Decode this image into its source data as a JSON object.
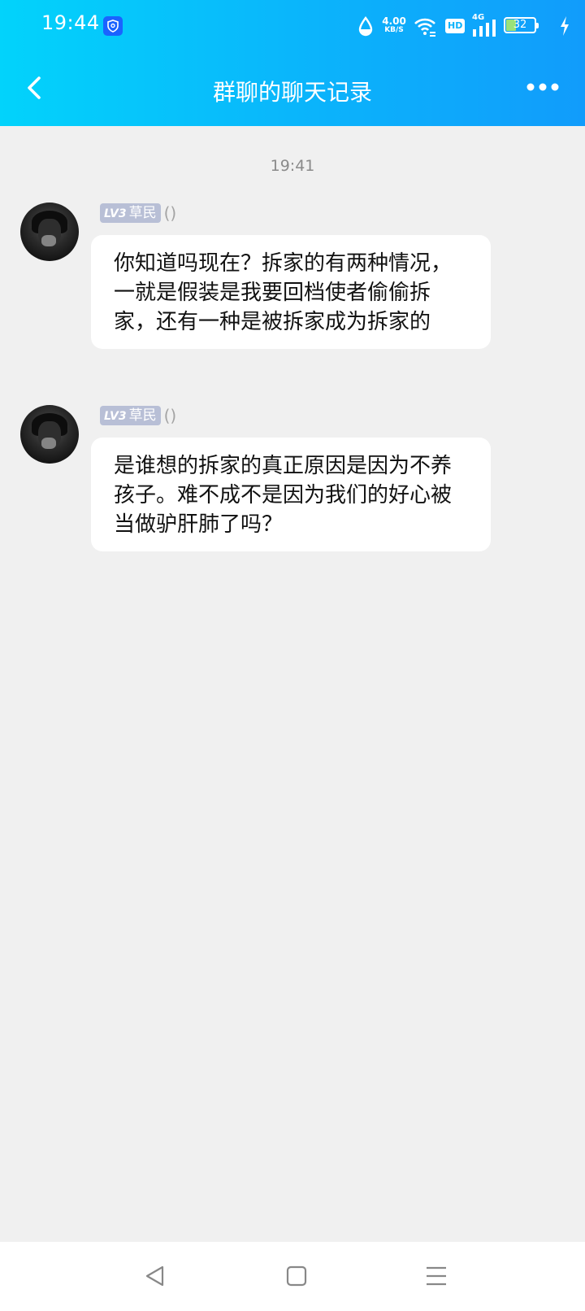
{
  "status_bar": {
    "time": "19:44",
    "speed_value": "4.00",
    "speed_unit": "KB/S",
    "hd_label": "HD",
    "network_label": "4G",
    "battery_level": "32"
  },
  "header": {
    "title": "群聊的聊天记录",
    "back_icon": "chevron-left-icon",
    "more_icon": "more-dots-icon"
  },
  "chat": {
    "timestamp": "19:41",
    "messages": [
      {
        "badge_level": "LV3",
        "badge_rank": "草民",
        "nickname": "()",
        "text": "你知道吗现在？拆家的有两种情况，一就是假装是我要回档使者偷偷拆家，还有一种是被拆家成为拆家的"
      },
      {
        "badge_level": "LV3",
        "badge_rank": "草民",
        "nickname": "()",
        "text": "是谁想的拆家的真正原因是因为不养孩子。难不成不是因为我们的好心被当做驴肝肺了吗？"
      }
    ]
  },
  "colors": {
    "header_gradient_start": "#02d3fb",
    "header_gradient_end": "#119cfb",
    "background": "#f0f0f0",
    "bubble": "#ffffff",
    "badge": "#b8bfd6"
  }
}
